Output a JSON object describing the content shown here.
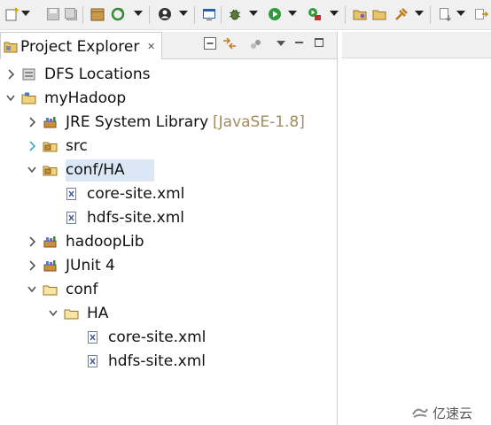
{
  "toolbar": {
    "icons": [
      "new-icon",
      "save-icon",
      "save-all-icon",
      "package-icon",
      "refresh-icon",
      "profile-icon",
      "console-icon",
      "debug-icon",
      "run-icon",
      "external-tools-icon",
      "open-folder-icon",
      "open-icon",
      "pin-icon",
      "navigate-icon"
    ]
  },
  "view": {
    "title": "Project Explorer",
    "close_glyph": "✕"
  },
  "tree": [
    {
      "label": "DFS Locations",
      "icon": "dfs-locations-icon",
      "expanded": false
    },
    {
      "label": "myHadoop",
      "icon": "project-icon",
      "expanded": true
    },
    {
      "label": "JRE System Library",
      "decoration": "[JavaSE-1.8]",
      "icon": "library-icon",
      "expanded": false
    },
    {
      "label": "src",
      "icon": "package-folder-icon",
      "expanded": false
    },
    {
      "label": "conf/HA",
      "icon": "package-folder-icon",
      "expanded": true,
      "selected": true
    },
    {
      "label": "core-site.xml",
      "icon": "xml-file-icon"
    },
    {
      "label": "hdfs-site.xml",
      "icon": "xml-file-icon"
    },
    {
      "label": "hadoopLib",
      "icon": "library-icon",
      "expanded": false
    },
    {
      "label": "JUnit 4",
      "icon": "library-icon",
      "expanded": false
    },
    {
      "label": "conf",
      "icon": "folder-icon",
      "expanded": true
    },
    {
      "label": "HA",
      "icon": "folder-icon",
      "expanded": true
    },
    {
      "label": "core-site.xml",
      "icon": "xml-file-icon"
    },
    {
      "label": "hdfs-site.xml",
      "icon": "xml-file-icon"
    }
  ],
  "watermark": "亿速云",
  "colors": {
    "selection": "#dbe7f5",
    "decoration": "#a38d5c",
    "chrome": "#f0f0f0"
  }
}
